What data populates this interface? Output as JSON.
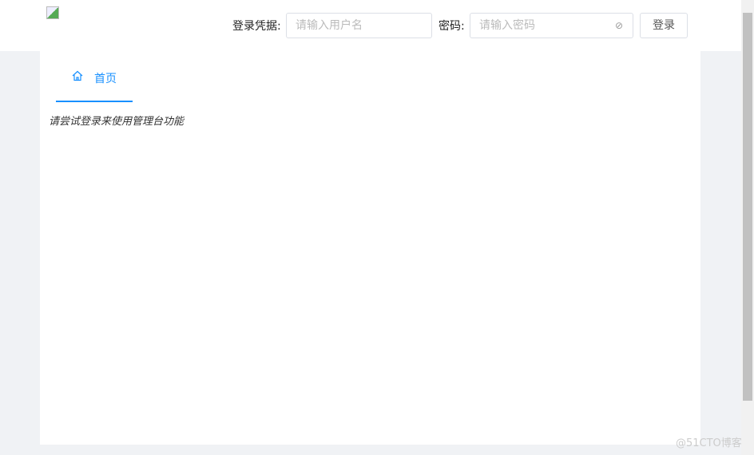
{
  "header": {
    "credential_label": "登录凭据:",
    "username_placeholder": "请输入用户名",
    "password_label": "密码:",
    "password_placeholder": "请输入密码",
    "login_button": "登录"
  },
  "tabs": [
    {
      "label": "首页",
      "icon": "home-icon"
    }
  ],
  "main": {
    "hint": "请尝试登录来使用管理台功能"
  },
  "watermark": "@51CTO博客",
  "colors": {
    "accent": "#1890ff"
  }
}
